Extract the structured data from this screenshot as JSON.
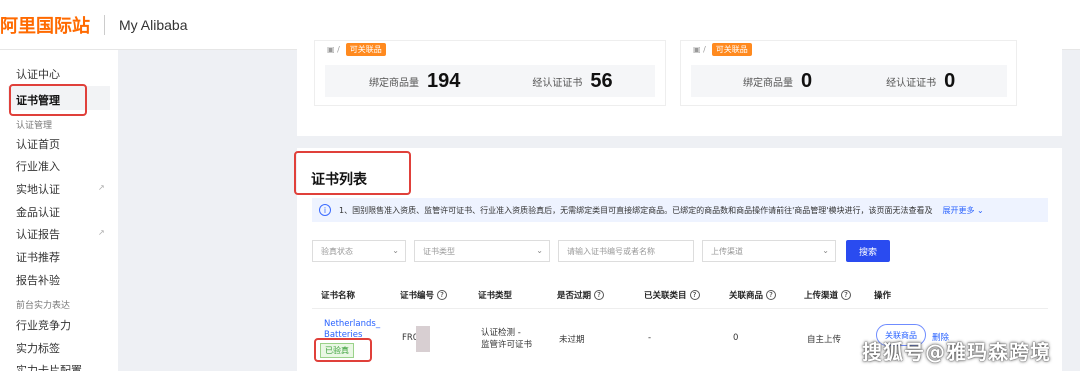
{
  "header": {
    "logo": "阿里国际站",
    "nav": "My Alibaba"
  },
  "sidebar": {
    "items": [
      {
        "label": "认证中心"
      },
      {
        "label": "证书管理"
      },
      {
        "label": "认证管理"
      },
      {
        "label": "认证首页"
      },
      {
        "label": "行业准入"
      },
      {
        "label": "实地认证"
      },
      {
        "label": "金品认证"
      },
      {
        "label": "认证报告"
      },
      {
        "label": "证书推荐"
      },
      {
        "label": "报告补验"
      },
      {
        "label": "前台实力表达"
      },
      {
        "label": "行业竞争力"
      },
      {
        "label": "实力标签"
      },
      {
        "label": "实力卡片配置"
      }
    ]
  },
  "stats": [
    {
      "tag": "可关联品",
      "bound_label": "绑定商品量",
      "bound_value": "194",
      "cert_label": "经认证证书",
      "cert_value": "56"
    },
    {
      "tag": "可关联品",
      "bound_label": "绑定商品量",
      "bound_value": "0",
      "cert_label": "经认证证书",
      "cert_value": "0"
    }
  ],
  "cert_list": {
    "title": "证书列表",
    "notice": "1、国别限售准入资质、监管许可证书、行业准入资质验真后，无需绑定类目可直接绑定商品。已绑定的商品数和商品操作请前往'商品管理'模块进行，该页面无法查看及",
    "expand": "展开更多",
    "filters": {
      "verify_status": "验真状态",
      "cert_type": "证书类型",
      "search_placeholder": "请输入证书编号或者名称",
      "upload_channel": "上传渠道",
      "search_button": "搜索"
    },
    "columns": [
      "证书名称",
      "证书编号",
      "证书类型",
      "是否过期",
      "已关联类目",
      "关联商品",
      "上传渠道",
      "操作"
    ],
    "rows": [
      {
        "name_line1": "Netherlands_",
        "name_line2": "Batteries",
        "status": "已验真",
        "number": "FR0",
        "type_line1": "认证检测 -",
        "type_line2": "监管许可证书",
        "expired": "未过期",
        "linked_categories": "-",
        "linked_products": "0",
        "channel": "自主上传",
        "action": "关联商品",
        "action2": "删除"
      }
    ]
  },
  "watermark": "搜狐号@雅玛森跨境"
}
